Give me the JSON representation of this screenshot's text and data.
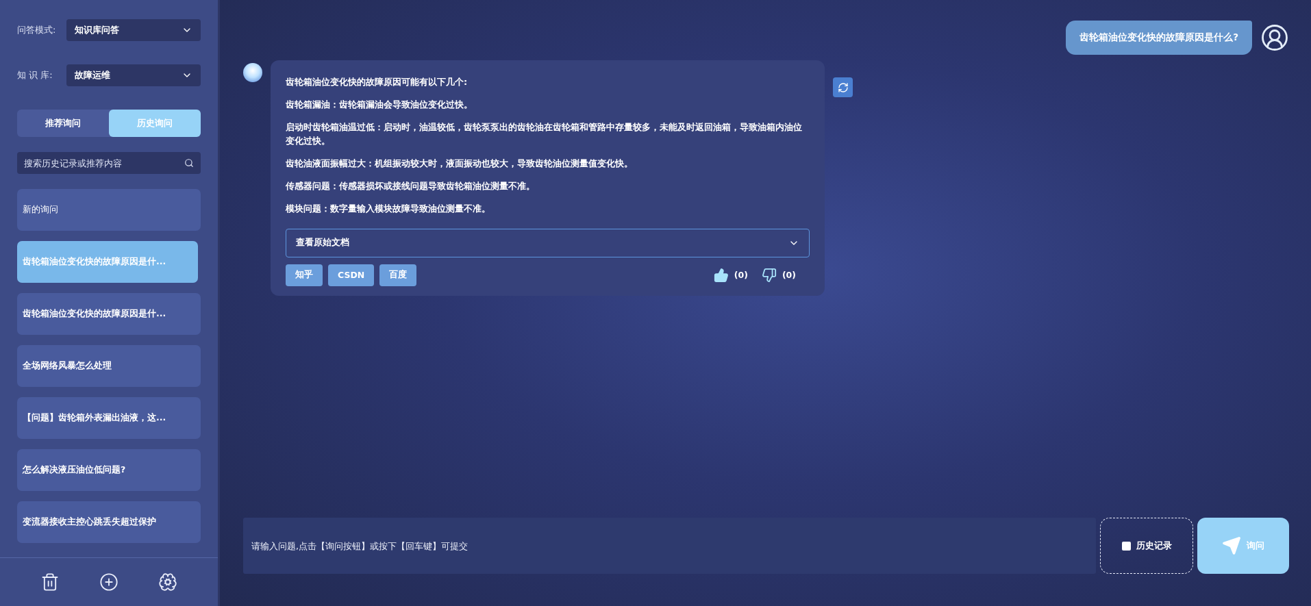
{
  "sidebar": {
    "mode_label": "问答模式:",
    "mode_value": "知识库问答",
    "kb_label": "知 识 库:",
    "kb_value": "故障运维",
    "tabs": [
      {
        "label": "推荐询问",
        "selected": false
      },
      {
        "label": "历史询问",
        "selected": true
      }
    ],
    "search": {
      "placeholder": "搜索历史记录或推荐内容"
    },
    "items": [
      {
        "label": "新的询问",
        "selected": false,
        "bold": false
      },
      {
        "label": "齿轮箱油位变化快的故障原因是什...",
        "selected": true,
        "bold": true
      },
      {
        "label": "齿轮箱油位变化快的故障原因是什...",
        "selected": false,
        "bold": true
      },
      {
        "label": "全场网络风暴怎么处理",
        "selected": false,
        "bold": true
      },
      {
        "label": "【问题】齿轮箱外表漏出油液，这...",
        "selected": false,
        "bold": true
      },
      {
        "label": "怎么解决液压油位低问题?",
        "selected": false,
        "bold": true
      },
      {
        "label": "变流器接收主控心跳丢失超过保护",
        "selected": false,
        "bold": true
      }
    ]
  },
  "chat": {
    "question": "齿轮箱油位变化快的故障原因是什么?",
    "answer": {
      "paragraphs": [
        "齿轮箱油位变化快的故障原因可能有以下几个:",
        "齿轮箱漏油：齿轮箱漏油会导致油位变化过快。",
        "启动时齿轮箱油温过低：启动时，油温较低，齿轮泵泵出的齿轮油在齿轮箱和管路中存量较多，未能及时返回油箱，导致油箱内油位变化过快。",
        "齿轮油液面振幅过大：机组振动较大时，液面振动也较大，导致齿轮油位测量值变化快。",
        "传感器问题：传感器损坏或接线问题导致齿轮箱油位测量不准。",
        "模块问题：数字量输入模块故障导致油位测量不准。"
      ],
      "docs_label": "查看原始文档",
      "sources": [
        "知乎",
        "CSDN",
        "百度"
      ],
      "likes": "(0)",
      "dislikes": "(0)"
    }
  },
  "input": {
    "placeholder": "请输入问题,点击【询问按钮】或按下【回车键】可提交",
    "history_label": "历史记录",
    "history_checked": false,
    "send_label": "询问"
  }
}
